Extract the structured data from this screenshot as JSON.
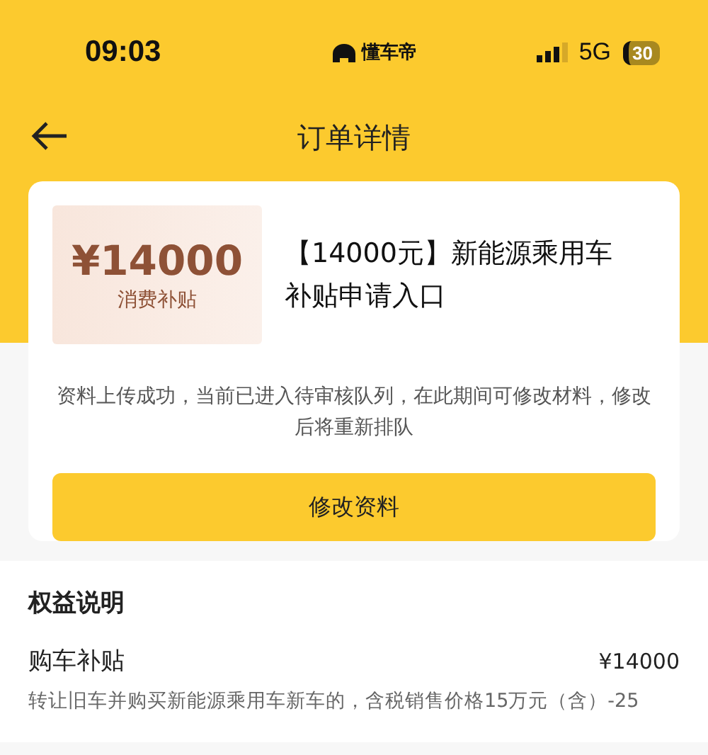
{
  "status_bar": {
    "time": "09:03",
    "app_name": "懂车帝",
    "network": "5G",
    "battery": "30"
  },
  "nav": {
    "title": "订单详情"
  },
  "order": {
    "coupon_amount": "¥14000",
    "coupon_label": "消费补贴",
    "title": "【14000元】新能源乘用车补贴申请入口",
    "notice": "资料上传成功，当前已进入待审核队列，在此期间可修改材料，修改后将重新排队",
    "button": "修改资料"
  },
  "benefits": {
    "heading": "权益说明",
    "items": [
      {
        "name": "购车补贴",
        "amount": "¥14000",
        "description": "转让旧车并购买新能源乘用车新车的，含税销售价格15万元（含）-25"
      }
    ]
  }
}
